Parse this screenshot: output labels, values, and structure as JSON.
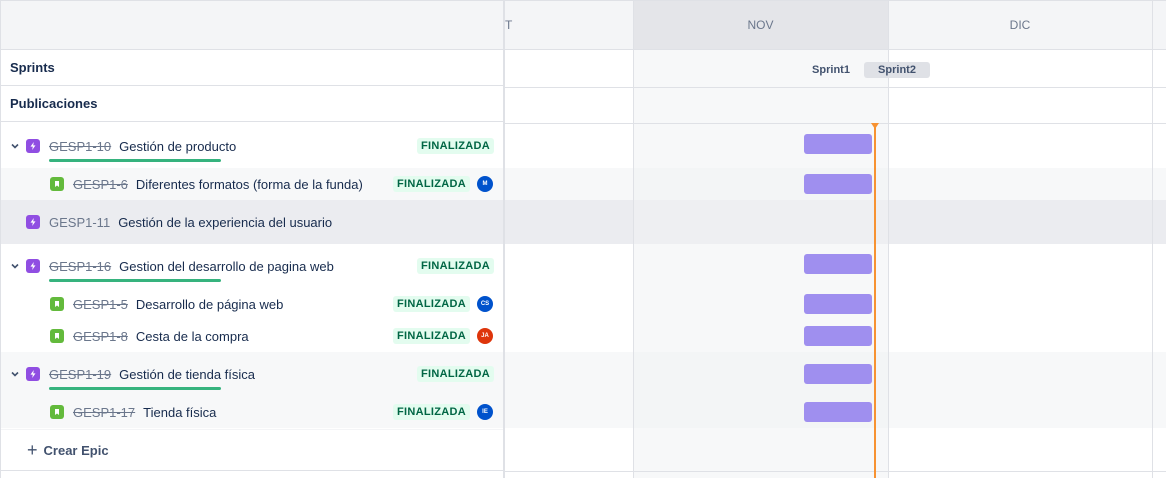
{
  "timeline": {
    "months": [
      "T",
      "NOV",
      "DIC"
    ],
    "sprints": [
      "Sprint1",
      "Sprint2"
    ]
  },
  "rows": {
    "sprints_label": "Sprints",
    "releases_label": "Publicaciones"
  },
  "epics": [
    {
      "key": "GESP1-10",
      "summary": "Gestión de producto",
      "status": "FINALIZADA",
      "done": true,
      "children": [
        {
          "key": "GESP1-6",
          "summary": "Diferentes formatos (forma de la funda)",
          "status": "FINALIZADA",
          "avatar": "M",
          "avatar_color": "#0052cc"
        }
      ]
    },
    {
      "key": "GESP1-11",
      "summary": "Gestión de la experiencia del usuario",
      "status": "",
      "done": false,
      "children": []
    },
    {
      "key": "GESP1-16",
      "summary": "Gestion del desarrollo de pagina web",
      "status": "FINALIZADA",
      "done": true,
      "children": [
        {
          "key": "GESP1-5",
          "summary": "Desarrollo de página web",
          "status": "FINALIZADA",
          "avatar": "CS",
          "avatar_color": "#0052cc"
        },
        {
          "key": "GESP1-8",
          "summary": "Cesta de la compra",
          "status": "FINALIZADA",
          "avatar": "JA",
          "avatar_color": "#de350b"
        }
      ]
    },
    {
      "key": "GESP1-19",
      "summary": "Gestión de tienda física",
      "status": "FINALIZADA",
      "done": true,
      "children": [
        {
          "key": "GESP1-17",
          "summary": "Tienda física",
          "status": "FINALIZADA",
          "avatar": "IE",
          "avatar_color": "#0052cc"
        }
      ]
    }
  ],
  "create_epic_label": "Crear Epic",
  "colors": {
    "epic_icon": "#904ee2",
    "story_icon": "#63ba3c",
    "bar": "#9f8fef",
    "today_line": "#f79232",
    "status_bg": "#e3fcef",
    "status_fg": "#006644"
  }
}
